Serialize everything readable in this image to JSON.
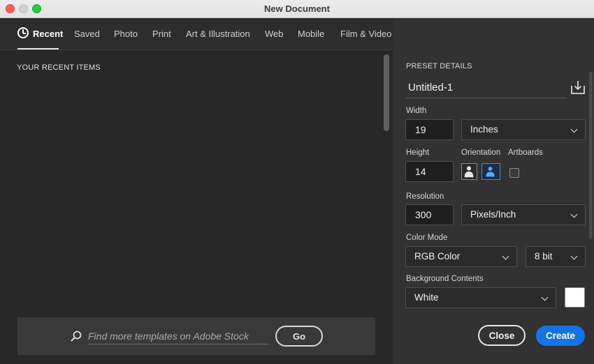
{
  "window": {
    "title": "New Document"
  },
  "tabs": [
    {
      "label": "Recent",
      "active": true
    },
    {
      "label": "Saved"
    },
    {
      "label": "Photo"
    },
    {
      "label": "Print"
    },
    {
      "label": "Art & Illustration"
    },
    {
      "label": "Web"
    },
    {
      "label": "Mobile"
    },
    {
      "label": "Film & Video"
    }
  ],
  "recent": {
    "heading": "YOUR RECENT ITEMS"
  },
  "stock": {
    "placeholder": "Find more templates on Adobe Stock",
    "go_label": "Go"
  },
  "preset": {
    "heading": "PRESET DETAILS",
    "name": "Untitled-1",
    "width_label": "Width",
    "width_value": "19",
    "width_unit": "Inches",
    "height_label": "Height",
    "height_value": "14",
    "orientation_label": "Orientation",
    "orientation_selected": "landscape",
    "artboards_label": "Artboards",
    "artboards_checked": false,
    "resolution_label": "Resolution",
    "resolution_value": "300",
    "resolution_unit": "Pixels/Inch",
    "color_mode_label": "Color Mode",
    "color_mode": "RGB Color",
    "bit_depth": "8 bit",
    "background_label": "Background Contents",
    "background": "White",
    "background_swatch": "#ffffff"
  },
  "actions": {
    "close_label": "Close",
    "create_label": "Create"
  },
  "colors": {
    "accent": "#1473e6",
    "panel": "#323232",
    "main": "#282828"
  }
}
